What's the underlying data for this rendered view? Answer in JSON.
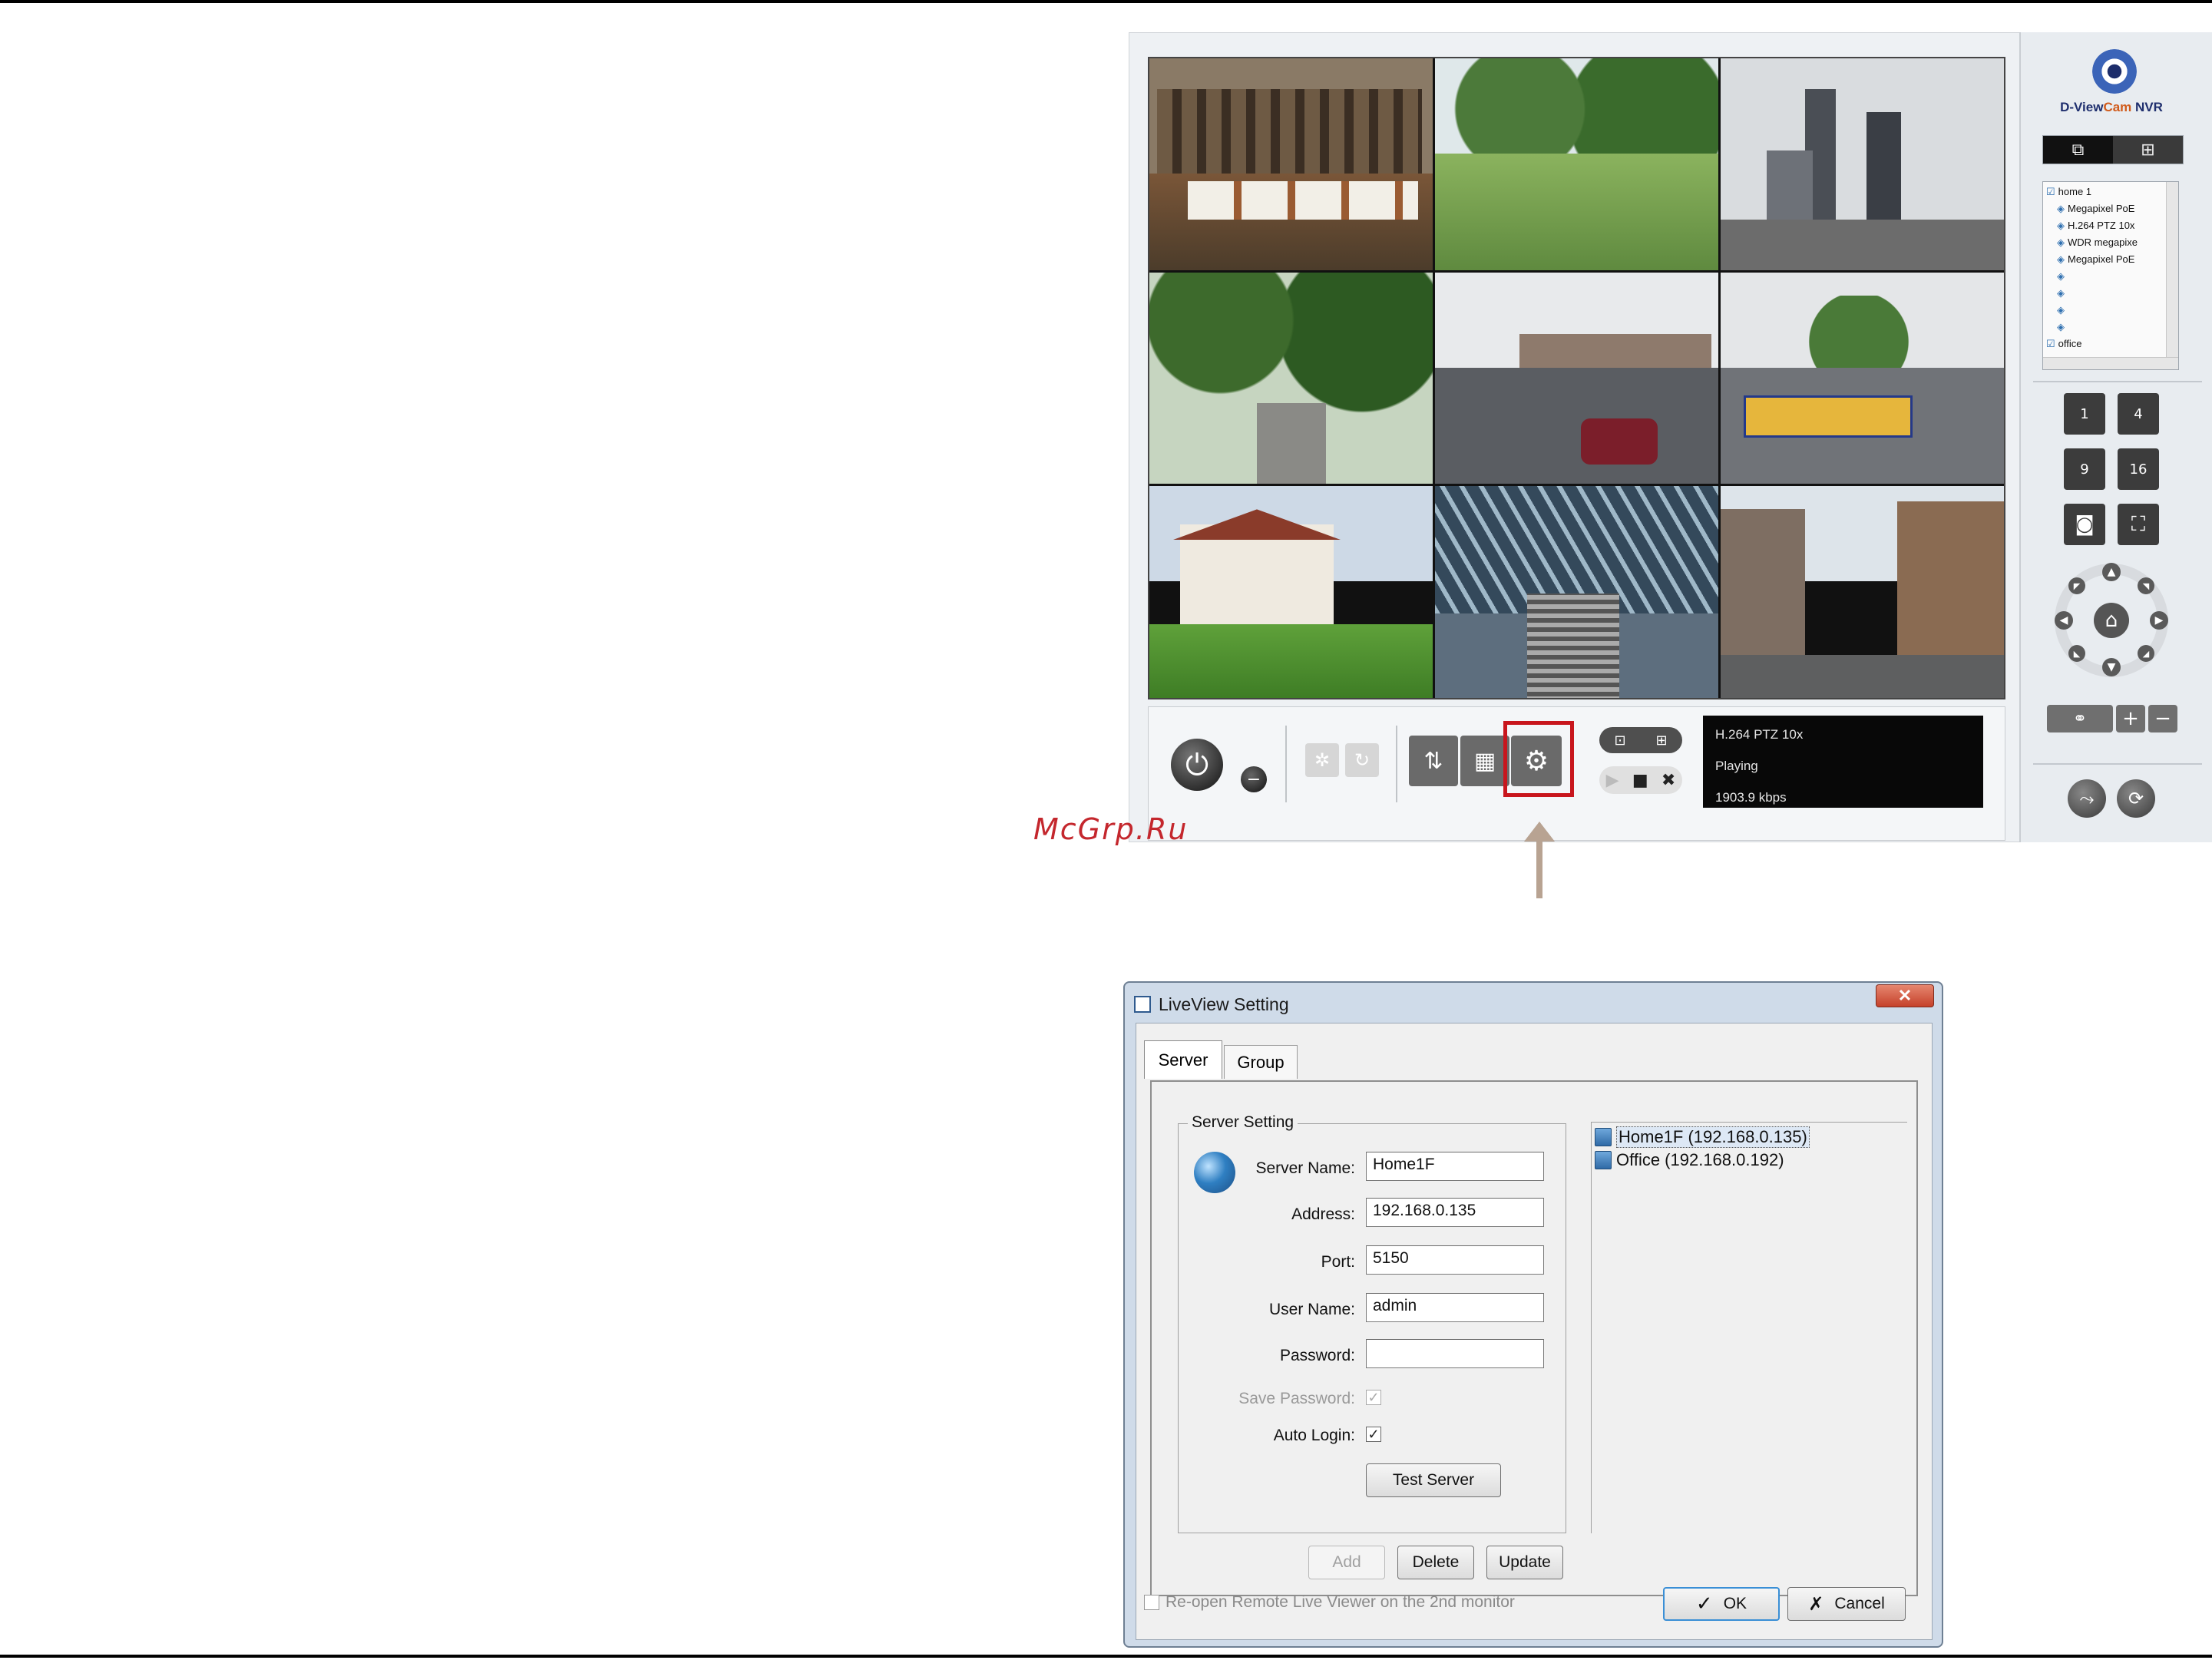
{
  "watermark": "McGrp.Ru",
  "nvr": {
    "logo_text_1": "D-View",
    "logo_text_2": "Cam",
    "logo_text_3": " NVR",
    "tree_items": [
      "home 1",
      "Megapixel PoE",
      "H.264 PTZ 10x",
      "WDR megapixe",
      "Megapixel PoE",
      "",
      "",
      "",
      "",
      "office"
    ],
    "layout_labels": [
      "1",
      "4",
      "9",
      "16"
    ],
    "status": {
      "camera": "H.264 PTZ 10x",
      "state": "Playing",
      "bitrate": "1903.9 kbps"
    },
    "colors": {
      "highlight": "#c8161d",
      "arrow": "#b8a392"
    }
  },
  "dialog": {
    "title": "LiveView Setting",
    "close_symbol": "✕",
    "tabs": [
      "Server",
      "Group"
    ],
    "group_title": "Server Setting",
    "fields": {
      "server_name_label": "Server Name:",
      "server_name_value": "Home1F",
      "address_label": "Address:",
      "address_value": "192.168.0.135",
      "port_label": "Port:",
      "port_value": "5150",
      "user_name_label": "User Name:",
      "user_name_value": "admin",
      "password_label": "Password:",
      "password_value": "",
      "save_password_label": "Save Password:",
      "auto_login_label": "Auto Login:"
    },
    "test_server_label": "Test Server",
    "servers": [
      "Home1F (192.168.0.135)",
      "Office (192.168.0.192)"
    ],
    "add_label": "Add",
    "delete_label": "Delete",
    "update_label": "Update",
    "reopen_label": "Re-open Remote Live Viewer on the 2nd monitor",
    "ok_label": "OK",
    "cancel_label": "Cancel"
  }
}
